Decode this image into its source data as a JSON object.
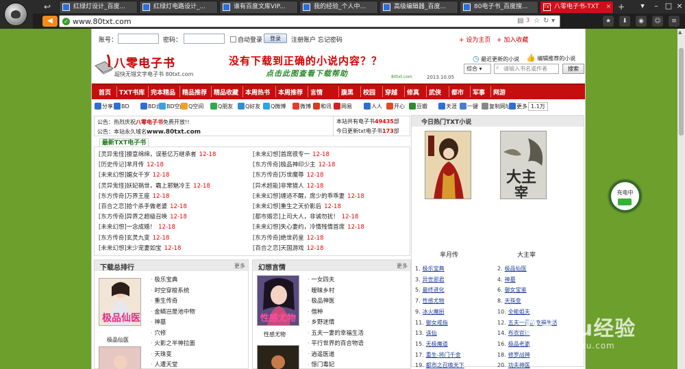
{
  "browser": {
    "tabs": [
      {
        "title": "红绿灯设计_百度..."
      },
      {
        "title": "红绿灯电路设计_..."
      },
      {
        "title": "谁有百度文库VIP..."
      },
      {
        "title": "我的经验_个人中..."
      },
      {
        "title": "高级编辑器_百度..."
      },
      {
        "title": "80电子书_百度搜..."
      },
      {
        "title": "八零电子书-TXT"
      }
    ],
    "active_tab_fav": "TXT",
    "url": "www.80txt.com",
    "notif_count": "3",
    "accent": "#d10d1c"
  },
  "login": {
    "account_label": "账号：",
    "password_label": "密码：",
    "auto_login": "自动登录",
    "login_button": "登录",
    "register": "注册账户 忘记密码",
    "set_home": "+ 设为主页",
    "add_fav": "+ 加入收藏"
  },
  "header": {
    "brand": "八零电子书",
    "brand_sub": "超快无错文字电子书 80txt.com",
    "slogan": "没有下载到正确的小说内容？？",
    "slogan_sub": "点击此图查看下载帮助",
    "slogan_site": "80txt.com",
    "slogan_date": "2013.10.05",
    "latest_link": "最近更新的小说",
    "rec_link": "编辑推荐的小说",
    "search_select": "综合",
    "search_placeholder": "请输入书名或作者",
    "search_button": "搜索"
  },
  "nav": [
    "首页",
    "TXT书库",
    "完本精品",
    "精品推荐",
    "精品收藏",
    "本周热书",
    "本周推荐",
    "言情",
    "腹黑",
    "校园",
    "穿越",
    "修真",
    "武侠",
    "都市",
    "军事",
    "网游"
  ],
  "share": {
    "label": "分享:",
    "items": [
      "BD",
      "BD云",
      "BD空间",
      "Q空间",
      "Q朋友",
      "Q好友",
      "Q微博",
      "微博",
      "和讯",
      "网易",
      "人人",
      "开心",
      "豆瓣",
      "天涯",
      "一键",
      "复制网址",
      "更多"
    ],
    "count": "1.1万"
  },
  "notice": {
    "line1_prefix": "公告：热烈庆祝",
    "line1_brand": "八零电子书",
    "line1_suffix": "免费开放!!",
    "line2_prefix": "公告：本站永久域名",
    "line2_domain": "www.80txt.com",
    "stat1_prefix": "本站共有电子书",
    "stat1_num": "49435",
    "stat1_unit": "部",
    "stat2_prefix": "今日更新txt电子书",
    "stat2_num": "173",
    "stat2_unit": "部"
  },
  "latest": {
    "tab": "最新TXT电子书",
    "left": [
      {
        "cat": "[灵异鬼怪]",
        "title": "撩意绵绵，误惹亿万继承者",
        "date": "12-18"
      },
      {
        "cat": "[历史传记]",
        "title": "芈月传",
        "date": "12-18"
      },
      {
        "cat": "[未来幻想]",
        "title": "媚女千岁",
        "date": "12-18"
      },
      {
        "cat": "[灵异鬼怪]",
        "title": "妖妃祸世，霸上邪魅冷王",
        "date": "12-18"
      },
      {
        "cat": "[东方传奇]",
        "title": "万界王座",
        "date": "12-18"
      },
      {
        "cat": "[百合之恋]",
        "title": "拾个杀手做老婆",
        "date": "12-18"
      },
      {
        "cat": "[东方传奇]",
        "title": "异界之超级召唤",
        "date": "12-18"
      },
      {
        "cat": "[未来幻想]",
        "title": "一念成婚！",
        "date": "12-18"
      },
      {
        "cat": "[东方传奇]",
        "title": "玄灵九变",
        "date": "12-18"
      },
      {
        "cat": "[未来幻想]",
        "title": "末少宠妻如宝",
        "date": "12-18"
      }
    ],
    "right": [
      {
        "cat": "[未来幻想]",
        "title": "首席很专一",
        "date": "12-18"
      },
      {
        "cat": "[东方传奇]",
        "title": "极品神印少主",
        "date": "12-18"
      },
      {
        "cat": "[东方传奇]",
        "title": "万世魔尊",
        "date": "12-18"
      },
      {
        "cat": "[异术超能]",
        "title": "非常猎人",
        "date": "12-18"
      },
      {
        "cat": "[未来幻想]",
        "title": "缠适不醒，席少的乖乖妻",
        "date": "12-18"
      },
      {
        "cat": "[未来幻想]",
        "title": "重生之天价影后",
        "date": "12-18"
      },
      {
        "cat": "[都市婚恋]",
        "title": "上司大人，非诚勿扰！",
        "date": "12-18"
      },
      {
        "cat": "[未来幻想]",
        "title": "失心妻约，冷情残情首席",
        "date": "12-18"
      },
      {
        "cat": "[东方传奇]",
        "title": "绝世药皇",
        "date": "12-18"
      },
      {
        "cat": "[百合之恋]",
        "title": "天国游戏",
        "date": "12-18"
      }
    ]
  },
  "hot": {
    "title": "今日热门TXT小说",
    "covers": [
      {
        "caption": "芈月传"
      },
      {
        "caption": "大主宰"
      }
    ],
    "left": [
      {
        "n": "1.",
        "t": "极乐宝典"
      },
      {
        "n": "3.",
        "t": "异世邪君"
      },
      {
        "n": "5.",
        "t": "最终进化"
      },
      {
        "n": "7.",
        "t": "性感尤物"
      },
      {
        "n": "9.",
        "t": "冰火魔厨"
      },
      {
        "n": "11.",
        "t": "御女戒指"
      },
      {
        "n": "13.",
        "t": "诛仙"
      },
      {
        "n": "15.",
        "t": "无极魔道"
      },
      {
        "n": "17.",
        "t": "重生-将门千金"
      },
      {
        "n": "19.",
        "t": "都市之召唤天下"
      }
    ],
    "right": [
      {
        "n": "2.",
        "t": "极品仙医"
      },
      {
        "n": "4.",
        "t": "神墓"
      },
      {
        "n": "6.",
        "t": "御女宝鉴"
      },
      {
        "n": "8.",
        "t": "天珠变"
      },
      {
        "n": "10.",
        "t": "全能姐夫"
      },
      {
        "n": "12.",
        "t": "五夫一妻的幸福生活"
      },
      {
        "n": "14.",
        "t": "布衣官道"
      },
      {
        "n": "16.",
        "t": "极品老婆"
      },
      {
        "n": "18.",
        "t": "修罗战神"
      },
      {
        "n": "20.",
        "t": "功夫神医"
      }
    ]
  },
  "download_rank": {
    "title": "下载总排行",
    "more": "更多",
    "cover_caption": "极品仙医",
    "items": [
      "极乐宝典",
      "时空穿梭系统",
      "重生传奇",
      "金鳞岂是池中物",
      "神墓",
      "穴修",
      "火影之半神拉面",
      "天珠变",
      "人遭天堂"
    ]
  },
  "fantasy": {
    "title": "幻想言情",
    "more": "更多",
    "cover_caption": "性感尤物",
    "items": [
      "一女四夫",
      "暧昧乡村",
      "极品神医",
      "借种",
      "乡野迷情",
      "五夫一妻的幸福生活",
      "平行世界的百合物语",
      "逍遥医道",
      "惊门毒妃"
    ]
  },
  "overlay": {
    "label": "充电中"
  },
  "watermark": {
    "big": "Baidu经验",
    "small": "jingyan.baidu.com"
  }
}
